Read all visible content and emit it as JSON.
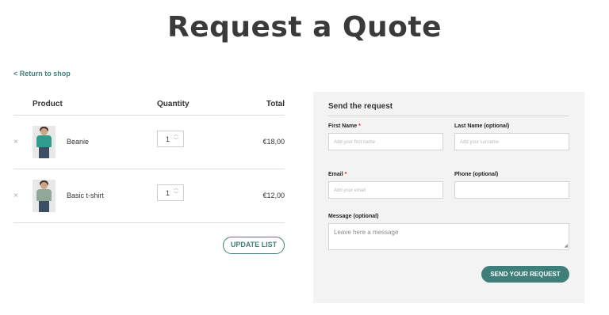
{
  "page": {
    "title": "Request a Quote"
  },
  "nav": {
    "return_label": "< Return to shop"
  },
  "cart": {
    "headers": {
      "product": "Product",
      "quantity": "Quantity",
      "total": "Total"
    },
    "rows": [
      {
        "remove": "×",
        "name": "Beanie",
        "quantity": "1",
        "total": "€18,00",
        "shirt_color": "#2f9c8c"
      },
      {
        "remove": "×",
        "name": "Basic t-shirt",
        "quantity": "1",
        "total": "€12,00",
        "shirt_color": "#8fa898"
      }
    ],
    "update_label": "UPDATE LIST"
  },
  "form": {
    "title": "Send the request",
    "first_name": {
      "label": "First Name",
      "required": "*",
      "placeholder": "Add your first name"
    },
    "last_name": {
      "label": "Last Name (optional)",
      "placeholder": "Add your surname"
    },
    "email": {
      "label": "Email",
      "required": "*",
      "placeholder": "Add your email"
    },
    "phone": {
      "label": "Phone (optional)",
      "placeholder": ""
    },
    "message": {
      "label": "Message (optional)",
      "placeholder": "Leave here a message"
    },
    "submit_label": "SEND YOUR REQUEST"
  },
  "colors": {
    "accent": "#3f7f7a",
    "panel_bg": "#f3f3f3",
    "required": "#e02424"
  }
}
